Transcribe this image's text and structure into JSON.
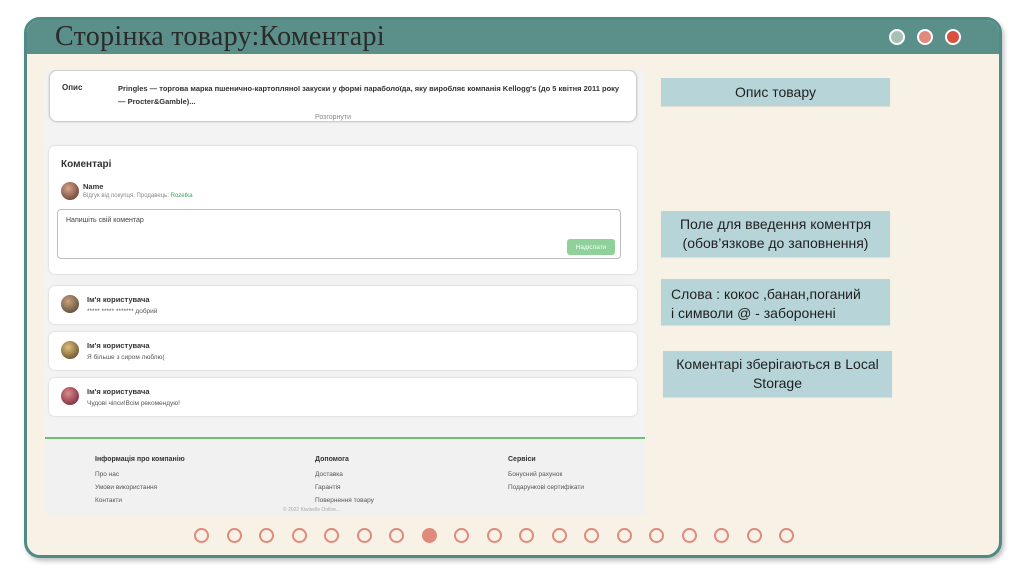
{
  "slide": {
    "title": "Сторінка товару:Коментарі",
    "window_dots": [
      {
        "name": "gray-dot",
        "color": "#a9c1b4"
      },
      {
        "name": "coral-dot",
        "color": "#e0897c"
      },
      {
        "name": "red-dot",
        "color": "#d9503f"
      }
    ]
  },
  "screenshot": {
    "description": {
      "label": "Опис",
      "text": "Pringles — торгова марка пшенично-картопляної закуски у формі параболоїда, яку виробляє компанія Kellogg's (до 5 квітня 2011 року — Procter&Gamble)...",
      "expand_link": "Розгорнути"
    },
    "comments": {
      "heading": "Коментарі",
      "author_name": "Name",
      "buyer_prefix": "Відгук від покупця. Продавець:",
      "seller": "Rozetka",
      "input_placeholder": "Напишіть свій коментар",
      "send_button": "Надіслати"
    },
    "user_comments": [
      {
        "name": "Ім'я користувача",
        "text": "***** ***** ******* добрий"
      },
      {
        "name": "Ім'я користувача",
        "text": "Я більше з сиром люблю("
      },
      {
        "name": "Ім'я користувача",
        "text": "Чудові чіпси!Всім рекомендую!"
      }
    ],
    "footer": {
      "col1_head": "Інформація про компанію",
      "col1_links": [
        "Про нас",
        "Умови використання",
        "Контакти"
      ],
      "col2_head": "Допомога",
      "col2_links": [
        "Доставка",
        "Гарантія",
        "Повернення товару"
      ],
      "col3_head": "Сервіси",
      "col3_links": [
        "Бонусний рахунок",
        "Подарункові сертифікати"
      ],
      "copyright": "© 2022 Kiwiselle Online..."
    }
  },
  "notes": {
    "description": "Опис товару",
    "field": "Поле для введення коментря (обов’язкове до заповнення)",
    "words_line1": "Слова : кокос ,банан,поганий",
    "words_line2": "і символи @ - заборонені",
    "storage": "Коментарі зберігаються в Local Storage"
  },
  "pager": {
    "total": 19,
    "active_index": 7,
    "color": "#e0897c"
  }
}
